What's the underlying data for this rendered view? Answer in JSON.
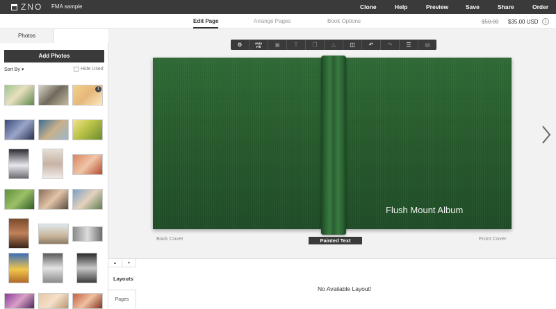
{
  "app": {
    "logo_text": "ZNO",
    "project_name": "FMA sample"
  },
  "topnav": [
    {
      "label": "Clone"
    },
    {
      "label": "Help"
    },
    {
      "label": "Preview"
    },
    {
      "label": "Save"
    },
    {
      "label": "Share"
    },
    {
      "label": "Order"
    }
  ],
  "tabs": [
    {
      "label": "Edit Page",
      "active": true
    },
    {
      "label": "Arrange Pages",
      "active": false
    },
    {
      "label": "Book Options",
      "active": false
    }
  ],
  "pricing": {
    "original": "$50.00",
    "current": "$35.00 USD"
  },
  "sidebar": {
    "tab_photos": "Photos",
    "add_photos": "Add Photos",
    "sort_by": "Sort By ▾",
    "hide_used": "Hide Used",
    "first_badge": "1"
  },
  "toolbar": {
    "autofill_line1": "Auto",
    "autofill_line2": "Fill"
  },
  "canvas": {
    "cover_title": "Flush Mount Album",
    "back_cover": "Back Cover",
    "front_cover": "Front Cover",
    "painted_text": "Painted Text",
    "cover_color": "#265a2c"
  },
  "bottom": {
    "layouts": "Layouts",
    "pages": "Pages",
    "no_layout": "No Available Layout!"
  }
}
